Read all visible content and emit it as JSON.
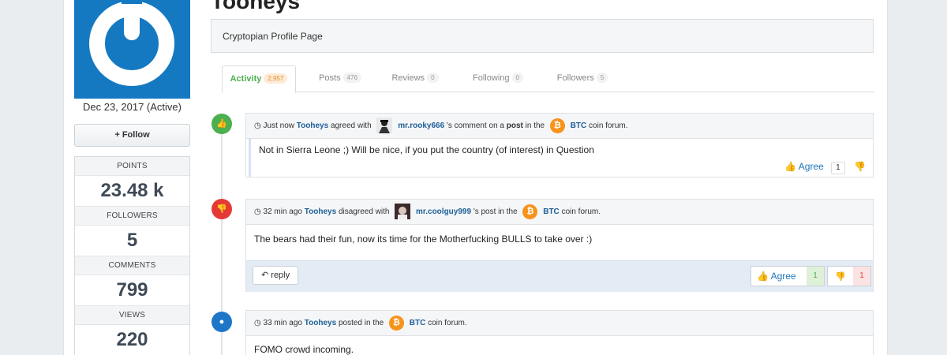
{
  "user": {
    "name": "Tooheys",
    "registered": "Dec 23, 2017 (Active)",
    "follow_label": "Follow",
    "profile_label": "Cryptopian Profile Page"
  },
  "stats": [
    {
      "label": "POINTS",
      "value": "23.48 k"
    },
    {
      "label": "FOLLOWERS",
      "value": "5"
    },
    {
      "label": "COMMENTS",
      "value": "799"
    },
    {
      "label": "VIEWS",
      "value": "220"
    }
  ],
  "tabs": [
    {
      "label": "Activity",
      "count": "2,957",
      "active": true
    },
    {
      "label": "Posts",
      "count": "476"
    },
    {
      "label": "Reviews",
      "count": "0"
    },
    {
      "label": "Following",
      "count": "0"
    },
    {
      "label": "Followers",
      "count": "5"
    }
  ],
  "activity": [
    {
      "time": "Just now",
      "actor": "Tooheys",
      "action": "agreed with",
      "target": "mr.rooky666",
      "suffix1": "'s comment on a",
      "object": "post",
      "suffix2": "in the",
      "forum": "BTC",
      "suffix3": "coin forum.",
      "body": "Not in Sierra Leone ;) Will be nice, if you put the country (of interest) in Question",
      "agree_label": "Agree",
      "agree_count": "1"
    },
    {
      "time": "32 min ago",
      "actor": "Tooheys",
      "action": "disagreed with",
      "target": "mr.coolguy999",
      "suffix1": "'s post in the",
      "forum": "BTC",
      "suffix3": "coin forum.",
      "body": "The bears had their fun, now its time for the Motherfucking BULLS to take over :)",
      "reply_label": "reply",
      "agree_label": "Agree",
      "agree_count": "1",
      "disagree_count": "1"
    },
    {
      "time": "33 min ago",
      "actor": "Tooheys",
      "action": "posted in the",
      "forum": "BTC",
      "suffix3": "coin forum.",
      "body": "FOMO crowd incoming."
    }
  ],
  "colors": {
    "agree": "#4caf50",
    "disagree": "#e53935",
    "post": "#1e76c8",
    "bitcoin": "#f7931a",
    "brand": "#1579c2"
  },
  "icons": {
    "agree": "thumbs-up-icon",
    "disagree": "thumbs-down-icon",
    "post": "comment-icon",
    "time": "clock-icon",
    "bitcoin": "bitcoin-icon"
  }
}
